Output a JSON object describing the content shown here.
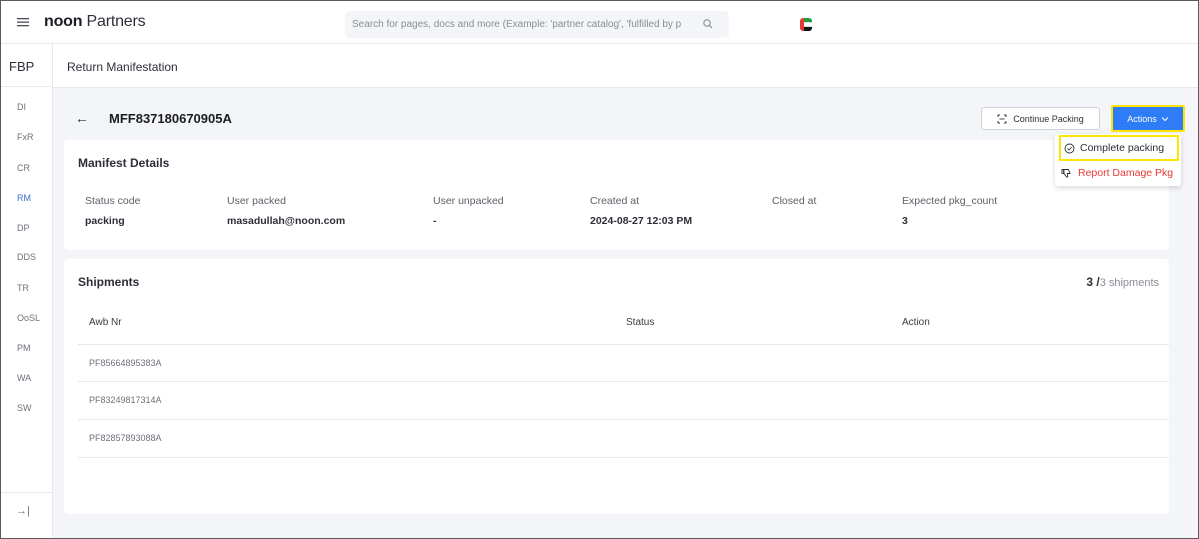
{
  "topbar": {
    "brand_bold": "noon",
    "brand_rest": "Partners",
    "search_placeholder": "Search for pages, docs and more (Example: 'partner catalog', 'fulfilled by p"
  },
  "sidebar": {
    "title": "FBP",
    "items": [
      {
        "label": "DI"
      },
      {
        "label": "FxR"
      },
      {
        "label": "CR"
      },
      {
        "label": "RM",
        "active": true
      },
      {
        "label": "DP"
      },
      {
        "label": "DDS"
      },
      {
        "label": "TR"
      },
      {
        "label": "OoSL"
      },
      {
        "label": "PM"
      },
      {
        "label": "WA"
      },
      {
        "label": "SW"
      }
    ],
    "collapse_glyph": "→|"
  },
  "page": {
    "title": "Return Manifestation",
    "manifest_id": "MFF837180670905A",
    "continue_label": "Continue Packing",
    "actions_label": "Actions"
  },
  "details": {
    "title": "Manifest Details",
    "fields": [
      {
        "label": "Status code",
        "value": "packing"
      },
      {
        "label": "User packed",
        "value": "masadullah@noon.com"
      },
      {
        "label": "User unpacked",
        "value": "-"
      },
      {
        "label": "Created at",
        "value": "2024-08-27 12:03 PM"
      },
      {
        "label": "Closed at",
        "value": ""
      },
      {
        "label": "Expected pkg_count",
        "value": "3"
      }
    ]
  },
  "shipments": {
    "title": "Shipments",
    "count_current": "3 /",
    "count_total": "3 shipments",
    "columns": [
      "Awb Nr",
      "Status",
      "Action"
    ],
    "rows": [
      {
        "awb": "PF85664895383A"
      },
      {
        "awb": "PF83249817314A"
      },
      {
        "awb": "PF82857893088A"
      }
    ]
  },
  "dropdown": {
    "complete_label": "Complete packing",
    "report_label": "Report Damage Pkg"
  },
  "colors": {
    "primary": "#2f7df6",
    "highlight": "#ffe600",
    "danger": "#e53935",
    "active_nav": "#3b6fc8"
  }
}
